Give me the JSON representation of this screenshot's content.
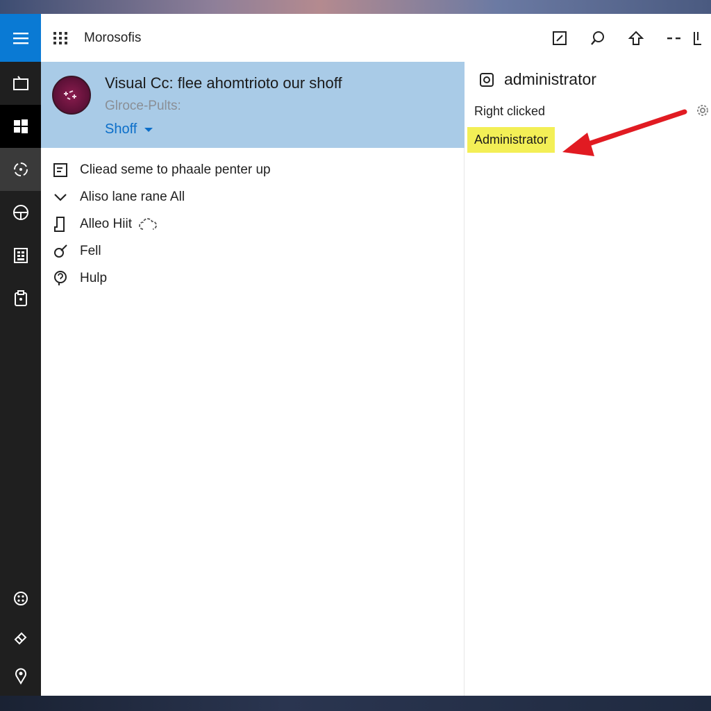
{
  "window": {
    "app_name": "Morosofis"
  },
  "rail": {
    "items": [
      "menu-icon",
      "tablet-icon",
      "windows-icon",
      "sync-icon",
      "steering-icon",
      "document-grid-icon",
      "clipboard-icon"
    ],
    "bottom": [
      "palette-icon",
      "eraser-icon",
      "location-icon"
    ],
    "accent": "#0a7ad4"
  },
  "topbar": {
    "actions": [
      "edit-icon",
      "search-icon",
      "share-icon",
      "more-icon",
      "bookmark-icon"
    ]
  },
  "header_card": {
    "title": "Visual Cc: flee ahomtrioto our shoff",
    "subtitle": "Glroce-Pults:",
    "link": "Shoff",
    "background": "#a9cbe7"
  },
  "menu": {
    "items": [
      {
        "label": "Cliead seme to phaale penter up",
        "icon": "window-icon"
      },
      {
        "label": "Aliso lane rane All",
        "icon": "chevron-down-icon"
      },
      {
        "label": "Alleo Hiit",
        "icon": "document-icon"
      },
      {
        "label": "Fell",
        "icon": "edit-check-icon"
      },
      {
        "label": "Hulp",
        "icon": "help-icon"
      }
    ]
  },
  "right_pane": {
    "title": "administrator",
    "subtitle": "Right clicked",
    "highlight": "Administrator",
    "highlight_color": "#f3ef56",
    "arrow_color": "#e11b22"
  }
}
